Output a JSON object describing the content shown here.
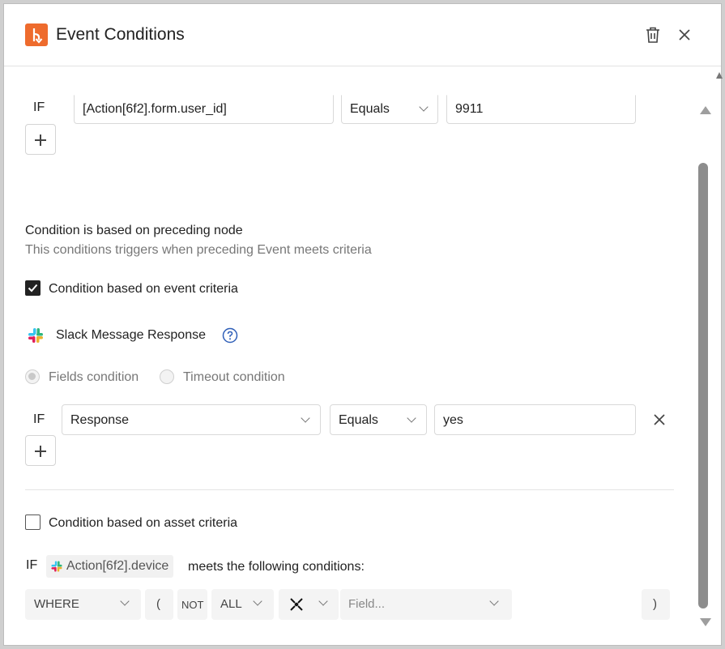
{
  "dialog": {
    "title": "Event Conditions",
    "accent_color": "#ee6b2d",
    "icons": {
      "app": "branch-icon",
      "delete": "trash-icon",
      "close": "close-icon"
    }
  },
  "top_condition": {
    "if_label": "IF",
    "field": "[Action[6f2].form.user_id]",
    "operator": "Equals",
    "value": "9911"
  },
  "preceding": {
    "heading": "Condition is based on preceding node",
    "description": "This conditions triggers when preceding Event meets criteria"
  },
  "event_criteria": {
    "label": "Condition based on event criteria",
    "checked": true
  },
  "source": {
    "name": "Slack Message Response",
    "icon": "slack-icon",
    "help_icon": "help-circle-icon"
  },
  "condition_mode": {
    "fields_label": "Fields condition",
    "timeout_label": "Timeout condition",
    "selected": "fields"
  },
  "slack_condition": {
    "if_label": "IF",
    "field": "Response",
    "operator": "Equals",
    "value": "yes"
  },
  "asset_criteria": {
    "label": "Condition based on asset criteria",
    "checked": false
  },
  "asset_query": {
    "if_label": "IF",
    "asset": "Action[6f2].device",
    "suffix": "meets the following conditions:",
    "where": "WHERE",
    "open_paren": "(",
    "not": "NOT",
    "quantifier": "ALL",
    "field_placeholder": "Field...",
    "close_paren": ")"
  }
}
